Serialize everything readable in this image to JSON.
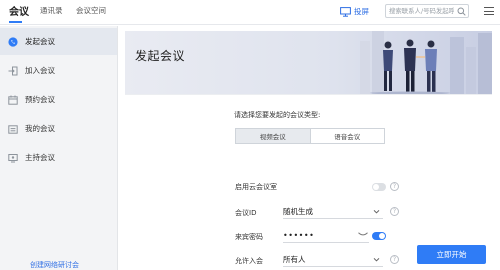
{
  "topbar": {
    "tabs": [
      {
        "label": "会议",
        "active": true
      },
      {
        "label": "通讯录",
        "active": false
      },
      {
        "label": "会议空间",
        "active": false
      }
    ],
    "screen_label": "投屏",
    "search_placeholder": "搜索联系人/号码发起呼叫"
  },
  "sidebar": {
    "items": [
      {
        "label": "发起会议",
        "icon": "phone-icon",
        "active": true
      },
      {
        "label": "加入会议",
        "icon": "join-icon",
        "active": false
      },
      {
        "label": "预约会议",
        "icon": "calendar-icon",
        "active": false
      },
      {
        "label": "我的会议",
        "icon": "calendar-list-icon",
        "active": false
      },
      {
        "label": "主持会议",
        "icon": "host-icon",
        "active": false
      }
    ],
    "footer_link": "创建网络研讨会"
  },
  "main": {
    "banner_title": "发起会议",
    "prompt": "请选择您要发起的会议类型:",
    "meeting_types": [
      {
        "label": "视频会议",
        "selected": true
      },
      {
        "label": "语音会议",
        "selected": false
      }
    ],
    "cloud_room_label": "启用云会议室",
    "cloud_room_enabled": false,
    "meeting_id_label": "会议ID",
    "meeting_id_value": "随机生成",
    "guest_password_label": "来宾密码",
    "guest_password_value": "••••••",
    "guest_password_enabled": true,
    "allow_join_label": "允许入会",
    "allow_join_value": "所有人",
    "start_button": "立即开始"
  },
  "colors": {
    "accent": "#2f7cf6",
    "sidebar_bg": "#f3f4f6",
    "sidebar_active": "#e4e8ef"
  }
}
